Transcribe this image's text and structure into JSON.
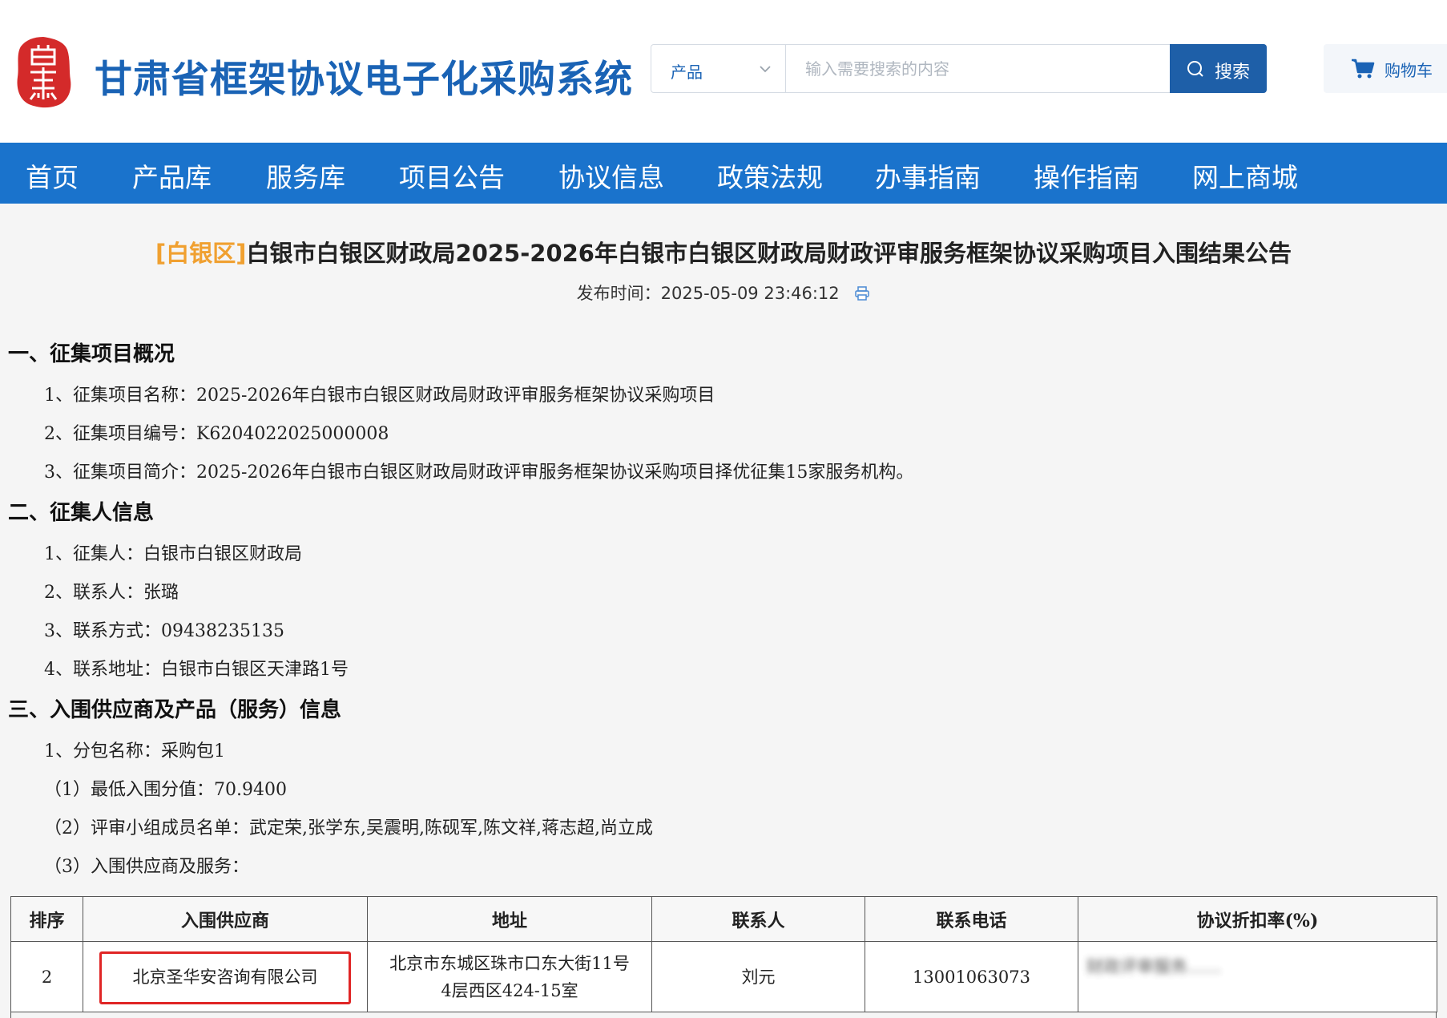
{
  "header": {
    "site_title": "甘肃省框架协议电子化采购系统",
    "logo_icon": "gansu-seal-logo",
    "search": {
      "category": "产品",
      "placeholder": "输入需要搜索的内容",
      "button_label": "搜索"
    },
    "cart_label": "购物车"
  },
  "nav": {
    "items": [
      "首页",
      "产品库",
      "服务库",
      "项目公告",
      "协议信息",
      "政策法规",
      "办事指南",
      "操作指南",
      "网上商城"
    ]
  },
  "article": {
    "district_tag": "[白银区]",
    "title": "白银市白银区财政局2025-2026年白银市白银区财政局财政评审服务框架协议采购项目入围结果公告",
    "publish_label": "发布时间：",
    "publish_time": "2025-05-09 23:46:12"
  },
  "sections": {
    "s1": {
      "heading": "一、征集项目概况",
      "lines": [
        "1、征集项目名称：2025-2026年白银市白银区财政局财政评审服务框架协议采购项目",
        "2、征集项目编号：K6204022025000008",
        "3、征集项目简介：2025-2026年白银市白银区财政局财政评审服务框架协议采购项目择优征集15家服务机构。"
      ]
    },
    "s2": {
      "heading": "二、征集人信息",
      "lines": [
        "1、征集人：白银市白银区财政局",
        "2、联系人：张璐",
        "3、联系方式：09438235135",
        "4、联系地址：白银市白银区天津路1号"
      ]
    },
    "s3": {
      "heading": "三、入围供应商及产品（服务）信息",
      "lines": [
        "1、分包名称：采购包1",
        "（1）最低入围分值：70.9400",
        "（2）评审小组成员名单：武定荣,张学东,吴震明,陈砚军,陈文祥,蒋志超,尚立成",
        "（3）入围供应商及服务："
      ]
    }
  },
  "table": {
    "headers": [
      "排序",
      "入围供应商",
      "地址",
      "联系人",
      "联系电话",
      "协议折扣率(%)"
    ],
    "rows": [
      {
        "rank": "2",
        "supplier": "北京圣华安咨询有限公司",
        "address_line1": "北京市东城区珠市口东大街11号",
        "address_line2": "4层西区424-15室",
        "contact": "刘元",
        "phone": "13001063073",
        "discount_blurred": "财政评审服务……"
      }
    ]
  },
  "colors": {
    "brand_blue": "#1a63b5",
    "nav_blue": "#1a73cc",
    "search_button": "#1e5fa8",
    "district_tag": "#f0a030",
    "highlight_red": "#e02525"
  }
}
